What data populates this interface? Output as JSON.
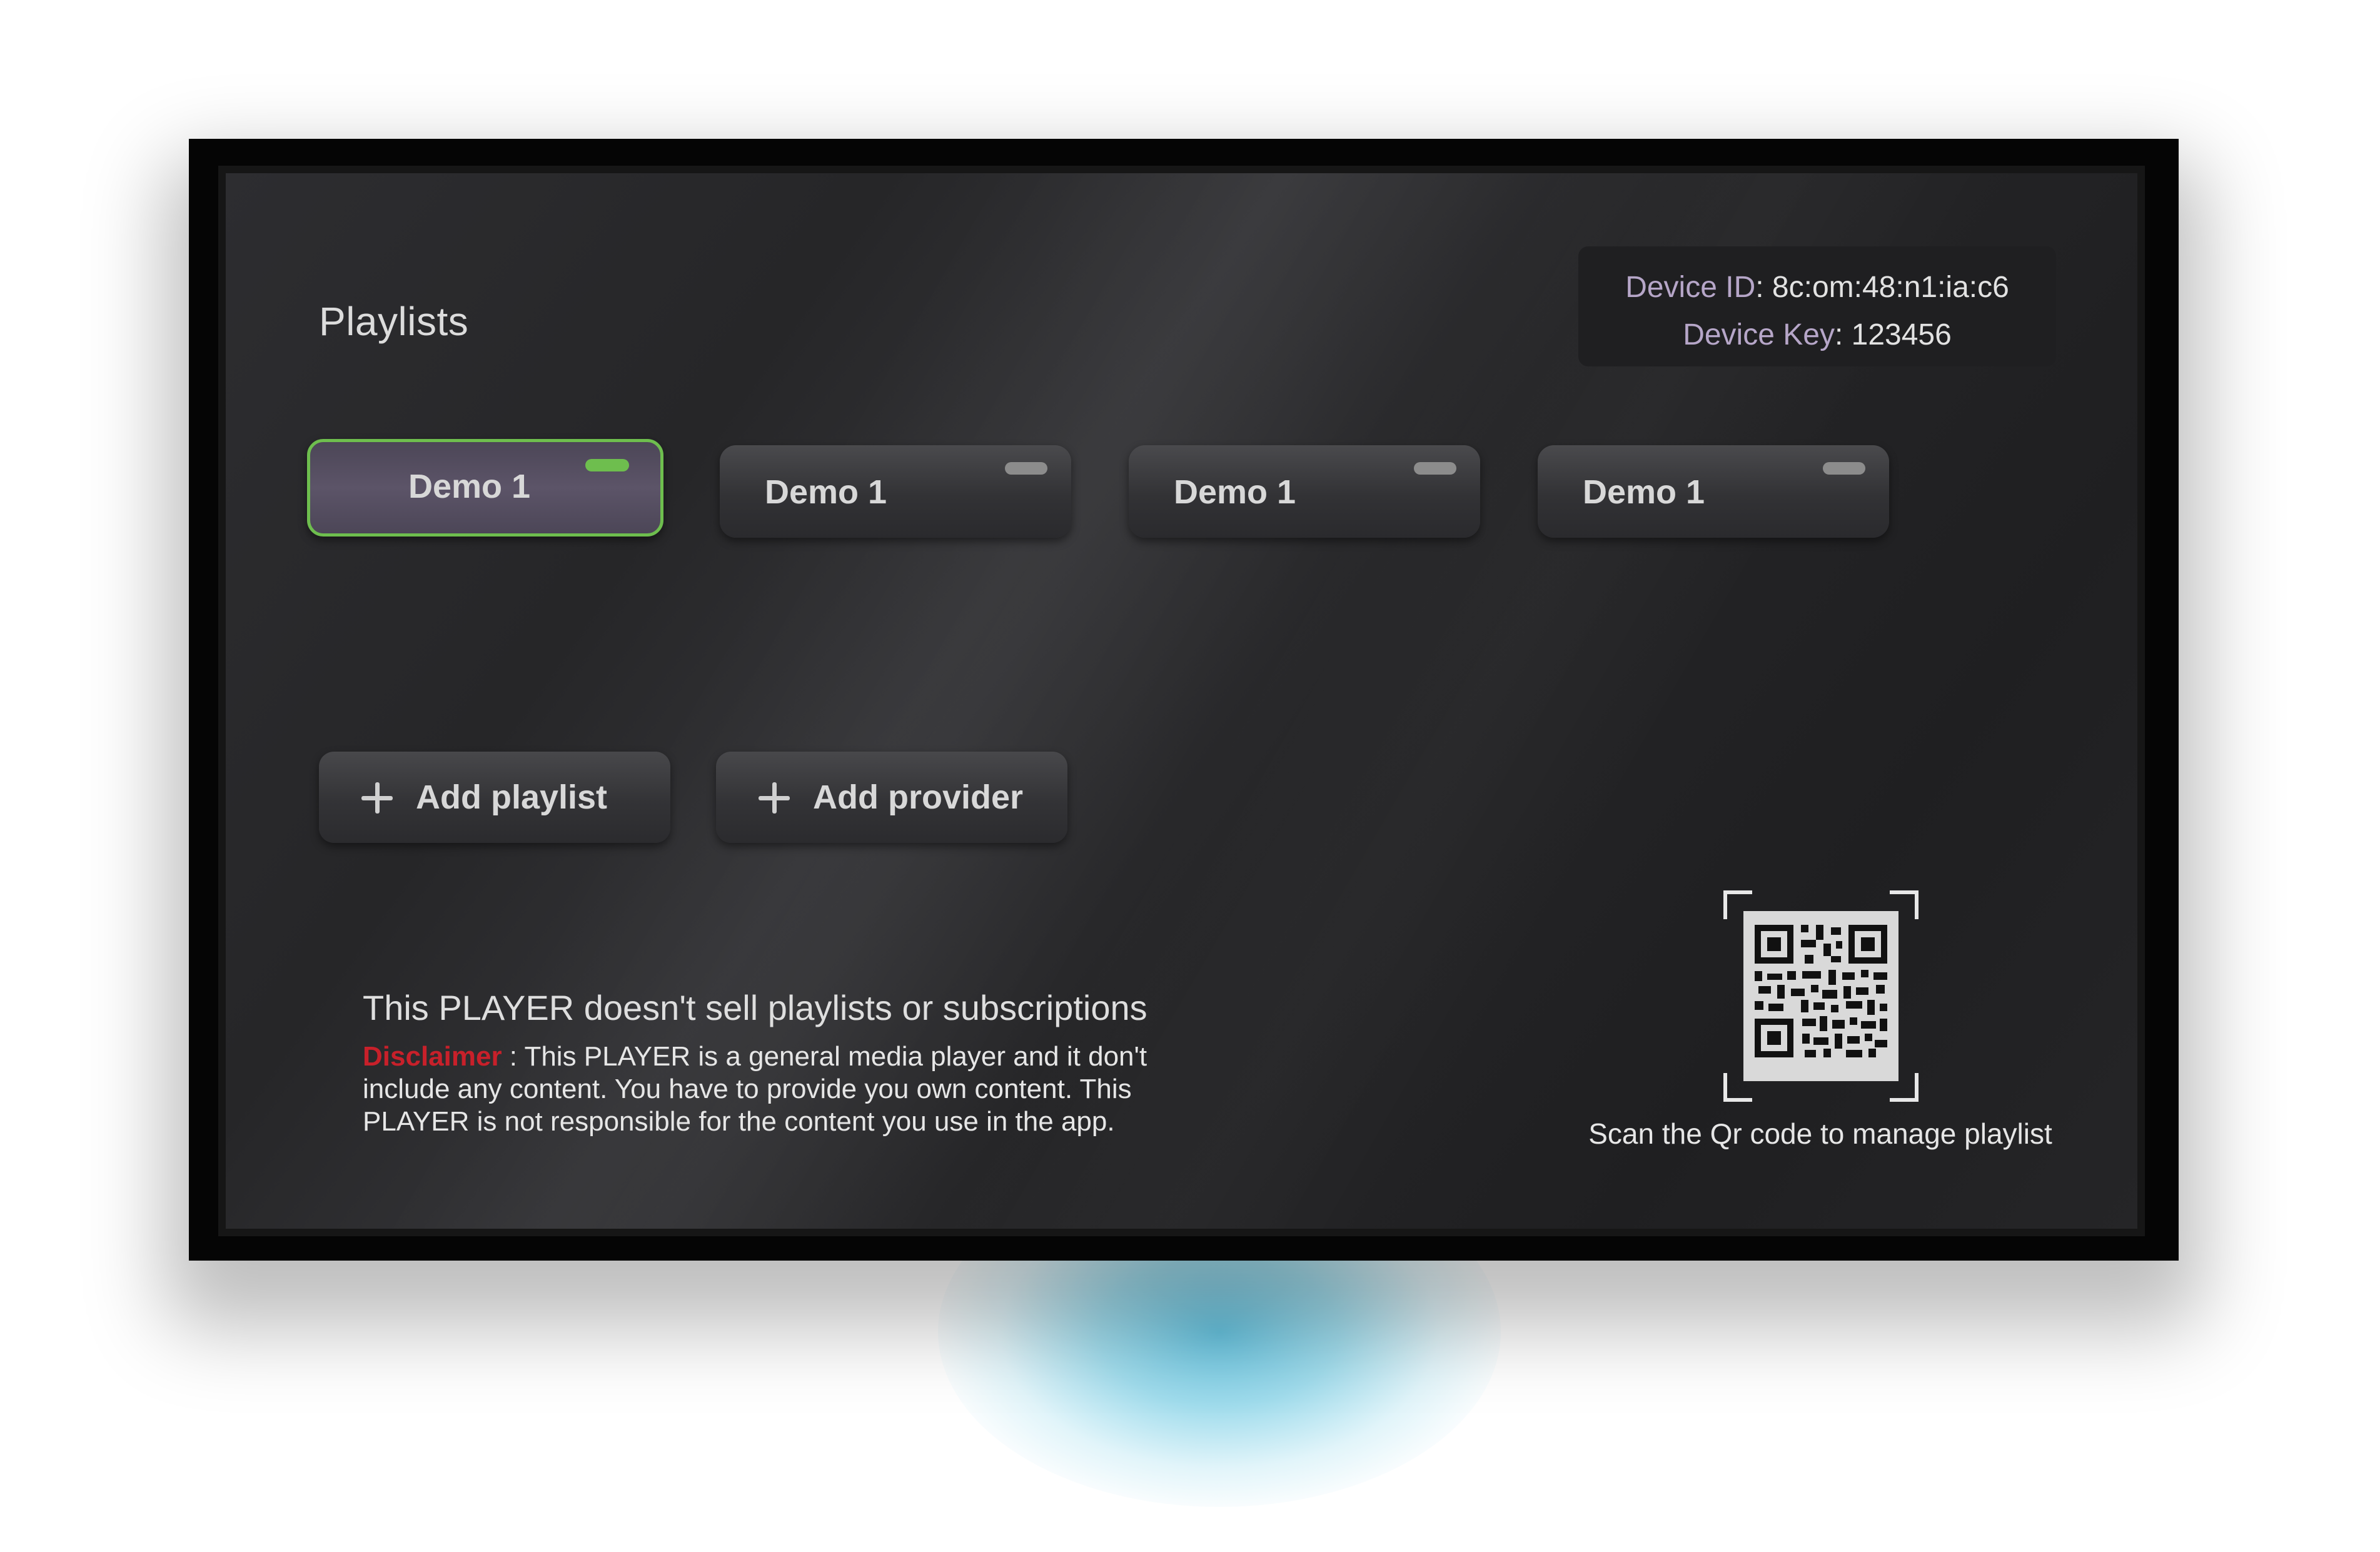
{
  "page": {
    "title": "Playlists"
  },
  "device": {
    "id_label": "Device ID",
    "id_value": "8c:om:48:n1:ia:c6",
    "key_label": "Device Key",
    "key_value": "123456"
  },
  "playlists": [
    {
      "label": "Demo 1",
      "selected": true,
      "status_color": "#6ebe4e"
    },
    {
      "label": "Demo 1",
      "selected": false,
      "status_color": "#8c8c8c"
    },
    {
      "label": "Demo 1",
      "selected": false,
      "status_color": "#8c8c8c"
    },
    {
      "label": "Demo 1",
      "selected": false,
      "status_color": "#8c8c8c"
    }
  ],
  "actions": {
    "add_playlist": {
      "label": "Add playlist",
      "icon": "plus-icon"
    },
    "add_provider": {
      "label": "Add provider",
      "icon": "plus-icon"
    }
  },
  "disclaimer": {
    "headline": "This PLAYER doesn't sell playlists or subscriptions",
    "tag": "Disclaimer",
    "text": " : This PLAYER is a general media player and it don't include any content. You have to provide you own content. This PLAYER is not responsible for the content you use in the app."
  },
  "qr": {
    "icon": "qr-code-icon",
    "caption": "Scan the Qr code to manage playlist"
  },
  "colors": {
    "accent_green": "#6ebe4e",
    "disclaimer_red": "#c8202a",
    "device_label": "#b6a6c8",
    "glow": "#60c0dd"
  }
}
